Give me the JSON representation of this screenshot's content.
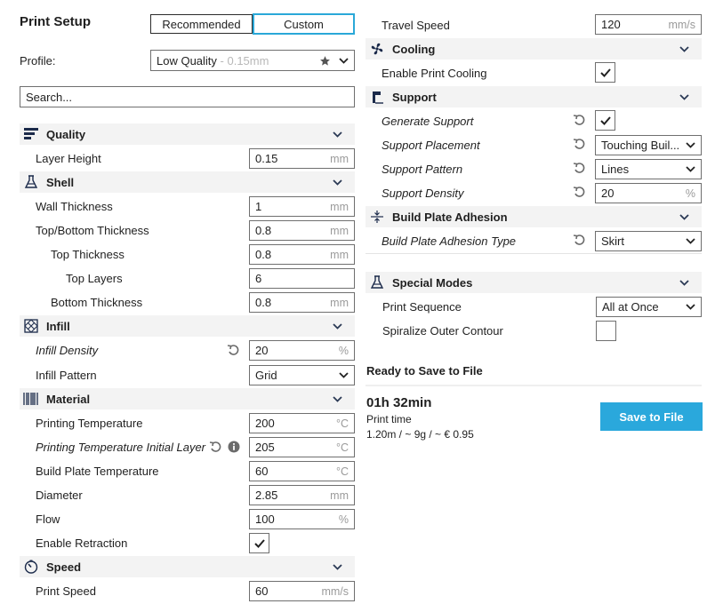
{
  "header": {
    "title": "Print Setup",
    "modes": [
      "Recommended",
      "Custom"
    ],
    "profile_label": "Profile:",
    "profile_value": "Low Quality",
    "profile_suffix": " - 0.15mm",
    "search_placeholder": "Search..."
  },
  "left": {
    "quality": {
      "label": "Quality",
      "layer_height": {
        "label": "Layer Height",
        "value": "0.15",
        "unit": "mm"
      }
    },
    "shell": {
      "label": "Shell",
      "wall_thickness": {
        "label": "Wall Thickness",
        "value": "1",
        "unit": "mm"
      },
      "top_bottom_thickness": {
        "label": "Top/Bottom Thickness",
        "value": "0.8",
        "unit": "mm"
      },
      "top_thickness": {
        "label": "Top Thickness",
        "value": "0.8",
        "unit": "mm"
      },
      "top_layers": {
        "label": "Top Layers",
        "value": "6"
      },
      "bottom_thickness": {
        "label": "Bottom Thickness",
        "value": "0.8",
        "unit": "mm"
      }
    },
    "infill": {
      "label": "Infill",
      "density": {
        "label": "Infill Density",
        "value": "20",
        "unit": "%"
      },
      "pattern": {
        "label": "Infill Pattern",
        "value": "Grid"
      }
    },
    "material": {
      "label": "Material",
      "print_temp": {
        "label": "Printing Temperature",
        "value": "200",
        "unit": "°C"
      },
      "print_temp_initial": {
        "label": "Printing Temperature Initial Layer",
        "value": "205",
        "unit": "°C"
      },
      "plate_temp": {
        "label": "Build Plate Temperature",
        "value": "60",
        "unit": "°C"
      },
      "diameter": {
        "label": "Diameter",
        "value": "2.85",
        "unit": "mm"
      },
      "flow": {
        "label": "Flow",
        "value": "100",
        "unit": "%"
      },
      "retraction": {
        "label": "Enable Retraction",
        "checked": true
      }
    },
    "speed": {
      "label": "Speed",
      "print_speed": {
        "label": "Print Speed",
        "value": "60",
        "unit": "mm/s"
      }
    }
  },
  "right": {
    "travel_speed": {
      "label": "Travel Speed",
      "value": "120",
      "unit": "mm/s"
    },
    "cooling": {
      "label": "Cooling",
      "enable": {
        "label": "Enable Print Cooling",
        "checked": true
      }
    },
    "support": {
      "label": "Support",
      "generate": {
        "label": "Generate Support",
        "checked": true
      },
      "placement": {
        "label": "Support Placement",
        "value": "Touching Buil..."
      },
      "pattern": {
        "label": "Support Pattern",
        "value": "Lines"
      },
      "density": {
        "label": "Support Density",
        "value": "20",
        "unit": "%"
      }
    },
    "adhesion": {
      "label": "Build Plate Adhesion",
      "type": {
        "label": "Build Plate Adhesion Type",
        "value": "Skirt"
      }
    },
    "special": {
      "label": "Special Modes",
      "sequence": {
        "label": "Print Sequence",
        "value": "All at Once"
      },
      "spiralize": {
        "label": "Spiralize Outer Contour",
        "checked": false
      }
    },
    "status": {
      "ready": "Ready to Save to File",
      "time": "01h 32min",
      "time_label": "Print time",
      "material_summary": "1.20m / ~ 9g / ~ € 0.95",
      "save_button": "Save to File"
    }
  },
  "colors": {
    "accent": "#2aa8dc",
    "section_bg": "#f3f3f3",
    "text": "#1f1f1f",
    "unit": "#9a9a9a"
  }
}
